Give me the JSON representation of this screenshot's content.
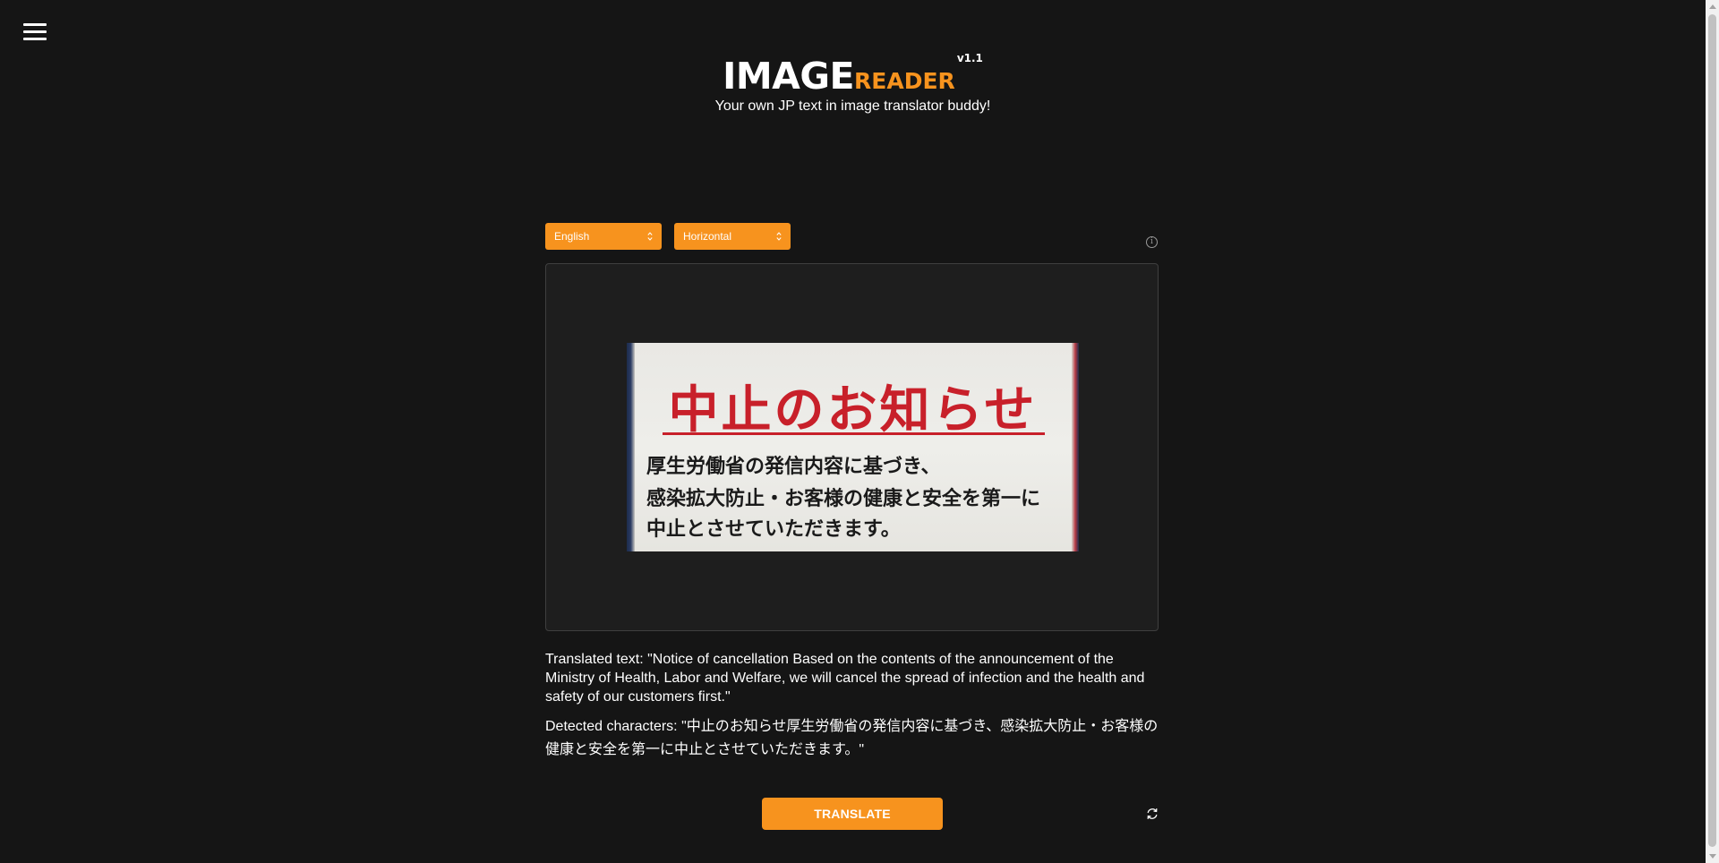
{
  "header": {
    "menu_icon": "hamburger-menu-icon",
    "logo": {
      "image": "IMAGE",
      "reader": "READER",
      "version": "v1.1"
    },
    "tagline": "Your own JP text in image translator buddy!"
  },
  "controls": {
    "language": {
      "selected": "English"
    },
    "orientation": {
      "selected": "Horizontal"
    },
    "info_icon": "info-icon"
  },
  "uploaded_image": {
    "title": "中止のお知らせ",
    "line1": "厚生労働省の発信内容に基づき、",
    "line2": "感染拡大防止・お客様の健康と安全を第一に",
    "line3": "中止とさせていただきます。"
  },
  "result": {
    "translated": "Translated text: \"Notice of cancellation Based on the contents of the announcement of the Ministry of Health, Labor and Welfare, we will cancel the spread of infection and the health and safety of our customers first.\"",
    "detected": "Detected characters: \"中止のお知らせ厚生労働省の発信内容に基づき、感染拡大防止・お客様の健康と安全を第一に中止とさせていただきます。\""
  },
  "actions": {
    "translate_label": "TRANSLATE",
    "refresh_icon": "refresh-icon"
  },
  "colors": {
    "accent": "#f7931e",
    "background": "#151515",
    "panel": "#1e1e1e"
  }
}
